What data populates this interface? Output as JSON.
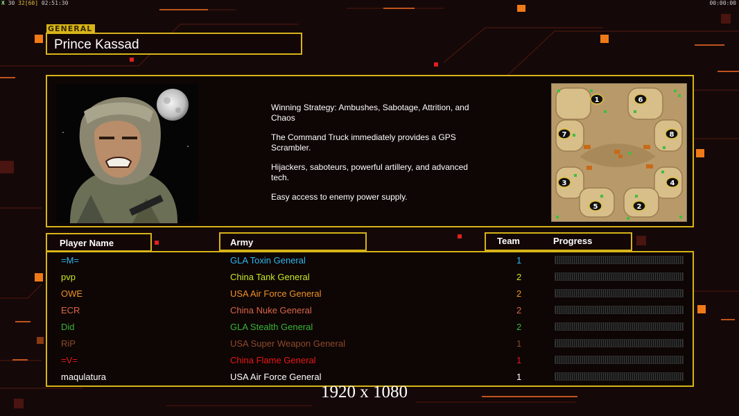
{
  "hud": {
    "left_prefix": "Ж",
    "fps_label": "30",
    "fps_values": "32[60]",
    "clock": "02:51:30",
    "right_clock": "00:00:00"
  },
  "general": {
    "tag": "GENERAL",
    "name": "Prince Kassad",
    "strategy_lines": [
      "Winning Strategy: Ambushes, Sabotage, Attrition, and\n Chaos",
      "The Command Truck immediately provides a GPS\n Scrambler.",
      "Hijackers, saboteurs, powerful artillery, and advanced\n tech.",
      "Easy access to enemy power supply."
    ]
  },
  "map": {
    "slots": [
      "1",
      "6",
      "7",
      "8",
      "3",
      "4",
      "5",
      "2"
    ]
  },
  "table": {
    "headers": {
      "player": "Player Name",
      "army": "Army",
      "team": "Team",
      "progress": "Progress"
    },
    "rows": [
      {
        "player": "=M=",
        "army": "GLA Toxin General",
        "team": "1",
        "color": "#2fb8ef",
        "progress": 0
      },
      {
        "player": "pvp",
        "army": "China Tank General",
        "team": "2",
        "color": "#c6e826",
        "progress": 0
      },
      {
        "player": "OWE",
        "army": "USA Air Force General",
        "team": "2",
        "color": "#ef9226",
        "progress": 0
      },
      {
        "player": "ECR",
        "army": "China Nuke General",
        "team": "2",
        "color": "#d86848",
        "progress": 0
      },
      {
        "player": "Did",
        "army": "GLA Stealth General",
        "team": "2",
        "color": "#36b636",
        "progress": 0
      },
      {
        "player": "RiP",
        "army": "USA Super Weapon General",
        "team": "1",
        "color": "#8c4a2a",
        "progress": 0
      },
      {
        "player": "=V=",
        "army": "China Flame General",
        "team": "1",
        "color": "#e81818",
        "progress": 0
      },
      {
        "player": "maqulatura",
        "army": "USA Air Force General",
        "team": "1",
        "color": "#ffffff",
        "progress": 0
      }
    ]
  },
  "resolution_label": "1920 x 1080"
}
